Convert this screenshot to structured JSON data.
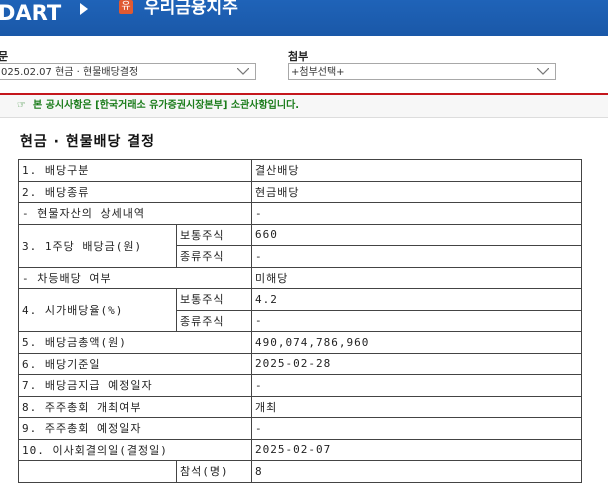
{
  "header": {
    "logo_text": "DART",
    "badge": "유",
    "company": "우리금융지주"
  },
  "report_select": {
    "label": "문",
    "value": "025.02.07  현금 · 현물배당결정"
  },
  "attachment_select": {
    "label": "첨부",
    "value": "+첨부선택+"
  },
  "notice": {
    "icon": "pointing-hand-icon",
    "text": "본 공시사항은 [한국거래소 유가증권시장본부] 소관사항입니다."
  },
  "doc_title": "현금 · 현물배당 결정",
  "table": {
    "r1": {
      "label": "1. 배당구분",
      "value": "결산배당"
    },
    "r2": {
      "label": "2. 배당종류",
      "value": "현금배당"
    },
    "r3": {
      "label": "- 현물자산의 상세내역",
      "value": "-"
    },
    "r4": {
      "label": "3. 1주당 배당금(원)",
      "sub1": "보통주식",
      "val1": "660",
      "sub2": "종류주식",
      "val2": "-"
    },
    "r5": {
      "label": "- 차등배당 여부",
      "value": "미해당"
    },
    "r6": {
      "label": "4. 시가배당율(%)",
      "sub1": "보통주식",
      "val1": "4.2",
      "sub2": "종류주식",
      "val2": "-"
    },
    "r7": {
      "label": "5. 배당금총액(원)",
      "value": "490,074,786,960"
    },
    "r8": {
      "label": "6. 배당기준일",
      "value": "2025-02-28"
    },
    "r9": {
      "label": "7. 배당금지급 예정일자",
      "value": "-"
    },
    "r10": {
      "label": "8. 주주총회 개최여부",
      "value": "개최"
    },
    "r11": {
      "label": "9. 주주총회 예정일자",
      "value": "-"
    },
    "r12": {
      "label": "10. 이사회결의일(결정일)",
      "value": "2025-02-07"
    },
    "r13": {
      "sub1": "참석(명)",
      "val1": "8"
    }
  }
}
